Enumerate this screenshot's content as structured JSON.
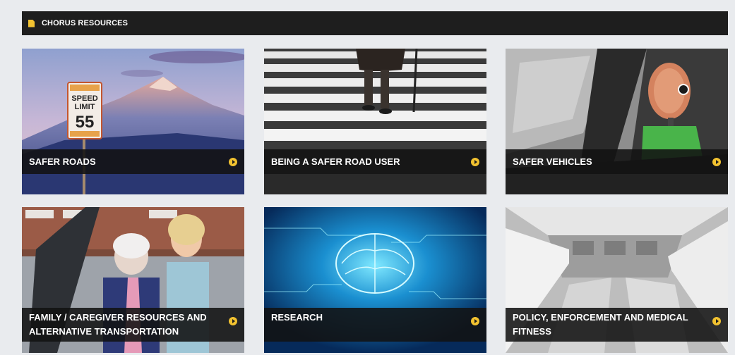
{
  "header": {
    "title": "CHORUS RESOURCES",
    "icon": "document-icon",
    "accent": "#f2c230"
  },
  "cards": [
    {
      "label": "SAFER ROADS",
      "sign_line1": "SPEED",
      "sign_line2": "LIMIT",
      "sign_value": "55"
    },
    {
      "label": "BEING A SAFER ROAD USER"
    },
    {
      "label": "SAFER VEHICLES"
    },
    {
      "label": "FAMILY / CAREGIVER RESOURCES AND ALTERNATIVE TRANSPORTATION"
    },
    {
      "label": "RESEARCH"
    },
    {
      "label": "POLICY, ENFORCEMENT AND MEDICAL FITNESS"
    }
  ],
  "colors": {
    "page_bg": "#e9ebee",
    "header_bg": "#1e1e1e",
    "arrow": "#f2c230"
  }
}
